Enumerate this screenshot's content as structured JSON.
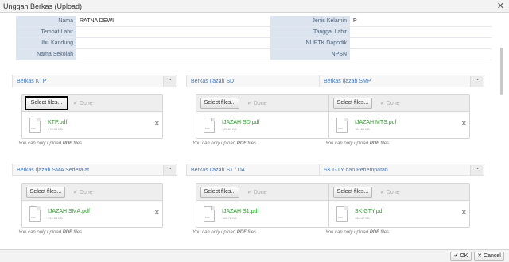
{
  "dialog": {
    "title": "Unggah Berkas (Upload)"
  },
  "student": {
    "rows": [
      {
        "left_label": "Nama",
        "left_value": "RATNA DEWI",
        "right_label": "Jenis Kelamin",
        "right_value": "P"
      },
      {
        "left_label": "Tempat Lahir",
        "left_value": "",
        "right_label": "Tanggal Lahir",
        "right_value": ""
      },
      {
        "left_label": "Ibu Kandung",
        "left_value": "",
        "right_label": "NUPTK Dapodik",
        "right_value": ""
      },
      {
        "left_label": "Nama Sekolah",
        "left_value": "",
        "right_label": "NPSN",
        "right_value": ""
      }
    ]
  },
  "uploader": {
    "select_label": "Select files...",
    "done_label": "Done",
    "remove_glyph": "✕",
    "file_ext_badge": "PDF",
    "hint_prefix": "You can only upload ",
    "hint_emph": "PDF",
    "hint_suffix": " files."
  },
  "panels": [
    {
      "title": "Berkas KTP",
      "file_name": "KTP.pdf",
      "file_size": "470.98 KB"
    },
    {
      "title": "Berkas Ijazah SD",
      "file_name": "IJAZAH SD.pdf",
      "file_size": "725.69 KB"
    },
    {
      "title": "Berkas Ijazah SMP",
      "file_name": "IJAZAH MTS.pdf",
      "file_size": "761.61 KB"
    },
    {
      "title": "Berkas Ijazah SMA Sederajat",
      "file_name": "IJAZAH SMA.pdf",
      "file_size": "712.24 KB"
    },
    {
      "title": "Berkas Ijazah S1 / D4",
      "file_name": "IJAZAH S1.pdf",
      "file_size": "165.72 KB"
    },
    {
      "title": "SK GTY dan Penempatan",
      "file_name": "SK GTY.pdf",
      "file_size": "380.47 KB"
    }
  ],
  "footer": {
    "ok_label": "OK",
    "cancel_label": "Cancel"
  },
  "icons": {
    "close": "close-icon",
    "collapse": "chevron-up-icon",
    "done": "check-icon",
    "file": "pdf-file-icon",
    "remove": "remove-icon",
    "ok": "check-icon",
    "cancel": "x-icon"
  },
  "colors": {
    "panel_title": "#4777b0",
    "file_name": "#2e9a2e",
    "label_bg": "#dbe4ef"
  }
}
